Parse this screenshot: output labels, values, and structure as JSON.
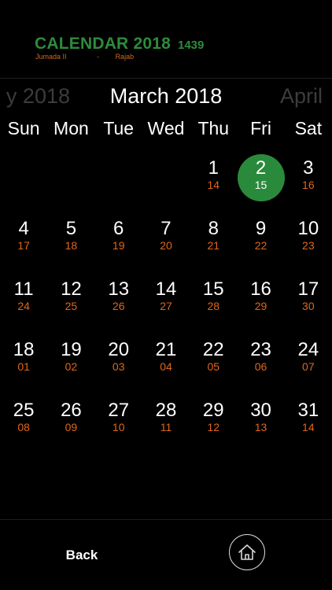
{
  "header": {
    "app_title": "CALENDAR 2018",
    "hijri_year": "1439",
    "hijri_month_start": "Jumada II",
    "hijri_separator": "-",
    "hijri_month_end": "Rajab"
  },
  "month_strip": {
    "previous": "y 2018",
    "current": "March 2018",
    "next": "April"
  },
  "weekdays": [
    "Sun",
    "Mon",
    "Tue",
    "Wed",
    "Thu",
    "Fri",
    "Sat"
  ],
  "weeks": [
    [
      null,
      null,
      null,
      null,
      {
        "g": "1",
        "h": "14"
      },
      {
        "g": "2",
        "h": "15",
        "today": true
      },
      {
        "g": "3",
        "h": "16"
      }
    ],
    [
      {
        "g": "4",
        "h": "17"
      },
      {
        "g": "5",
        "h": "18"
      },
      {
        "g": "6",
        "h": "19"
      },
      {
        "g": "7",
        "h": "20"
      },
      {
        "g": "8",
        "h": "21"
      },
      {
        "g": "9",
        "h": "22"
      },
      {
        "g": "10",
        "h": "23"
      }
    ],
    [
      {
        "g": "11",
        "h": "24"
      },
      {
        "g": "12",
        "h": "25"
      },
      {
        "g": "13",
        "h": "26"
      },
      {
        "g": "14",
        "h": "27"
      },
      {
        "g": "15",
        "h": "28"
      },
      {
        "g": "16",
        "h": "29"
      },
      {
        "g": "17",
        "h": "30"
      }
    ],
    [
      {
        "g": "18",
        "h": "01"
      },
      {
        "g": "19",
        "h": "02"
      },
      {
        "g": "20",
        "h": "03"
      },
      {
        "g": "21",
        "h": "04"
      },
      {
        "g": "22",
        "h": "05"
      },
      {
        "g": "23",
        "h": "06"
      },
      {
        "g": "24",
        "h": "07"
      }
    ],
    [
      {
        "g": "25",
        "h": "08"
      },
      {
        "g": "26",
        "h": "09"
      },
      {
        "g": "27",
        "h": "10"
      },
      {
        "g": "28",
        "h": "11"
      },
      {
        "g": "29",
        "h": "12"
      },
      {
        "g": "30",
        "h": "13"
      },
      {
        "g": "31",
        "h": "14"
      }
    ]
  ],
  "footer": {
    "back_label": "Back",
    "home_icon": "home-icon"
  },
  "colors": {
    "accent_green": "#2a8a3c",
    "title_green": "#2e8b3a",
    "hijri_orange": "#e0661b",
    "background": "#000000"
  }
}
